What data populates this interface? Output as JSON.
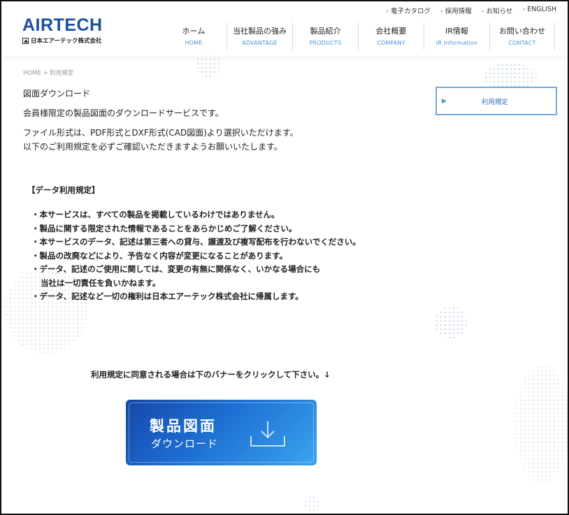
{
  "header": {
    "logo_main": "AIRTECH",
    "logo_sub": "日本エアーテック株式会社",
    "utility_links": [
      {
        "label": "電子カタログ"
      },
      {
        "label": "採用情報"
      },
      {
        "label": "お知らせ"
      },
      {
        "label": "ENGLISH"
      }
    ],
    "nav": [
      {
        "ja": "ホーム",
        "en": "HOME"
      },
      {
        "ja": "当社製品の強み",
        "en": "ADVANTAGE"
      },
      {
        "ja": "製品紹介",
        "en": "PRODUCTS"
      },
      {
        "ja": "会社概要",
        "en": "COMPANY"
      },
      {
        "ja": "IR情報",
        "en": "IR Information"
      },
      {
        "ja": "お問い合わせ",
        "en": "CONTACT"
      }
    ]
  },
  "breadcrumb": "HOME > 利用規定",
  "main": {
    "title": "図面ダウンロード",
    "intro": "会員様限定の製品図面のダウンロードサービスです。",
    "format_line1": "ファイル形式は、PDF形式とDXF形式(CAD図面)より選択いただけます。",
    "format_line2": "以下のご利用規定を必ずご確認いただきますようお願いいたします。",
    "rules_heading": "【データ利用規定】",
    "rules": [
      "・本サービスは、すべての製品を掲載しているわけではありません。",
      "・製品に関する限定された情報であることをあらかじめご了解ください。",
      "・本サービスのデータ、記述は第三者への貸与、譲渡及び複写配布を行わないでください。",
      "・製品の改廃などにより、予告なく内容が変更になることがあります。",
      "・データ、記述のご使用に関しては、変更の有無に関係なく、いかなる場合にも",
      "当社は一切責任を負いかねます。",
      "・データ、記述など一切の権利は日本エアーテック株式会社に帰属します。"
    ],
    "agree_text": "利用規定に同意される場合は下のバナーをクリックして下さい。↓",
    "banner_line1": "製品図面",
    "banner_line2": "ダウンロード",
    "banner_icon": "download-tray-icon"
  },
  "side": {
    "label": "利用規定",
    "arrow": "▶"
  },
  "colors": {
    "brand": "#1c4f9f",
    "nav_en": "#4a90d9",
    "side_border": "#6fa9e3",
    "banner_gradient": [
      "#1547a8",
      "#3aa4ef"
    ]
  }
}
